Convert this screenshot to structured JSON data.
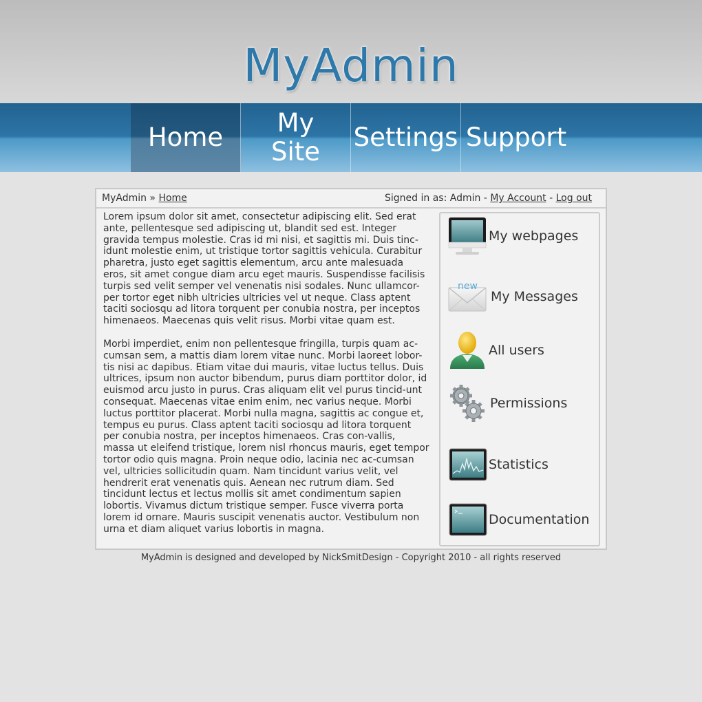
{
  "header": {
    "logo": "MyAdmin"
  },
  "nav": {
    "home": "Home",
    "my_site": "My\nSite",
    "settings": "Settings",
    "support": "Support"
  },
  "breadcrumb": {
    "root": "MyAdmin",
    "separator": " » ",
    "current": "Home"
  },
  "account": {
    "signed_in_prefix": "Signed in as: Admin - ",
    "my_account": "My Account",
    "dash": " - ",
    "logout": "Log out"
  },
  "content": {
    "para1": "Lorem ipsum dolor sit amet, consectetur adipiscing elit. Sed erat ante, pellentesque sed adipiscing ut, blandit sed est. Integer gravida tempus molestie. Cras id mi nisi, et sagittis mi. Duis tinc-idunt molestie enim, ut tristique tortor sagittis vehicula. Curabitur pharetra, justo eget sagittis elementum, arcu ante malesuada eros, sit amet congue diam arcu eget mauris. Suspendisse facilisis turpis sed velit semper vel venenatis nisi sodales. Nunc ullamcor-per tortor eget nibh ultricies ultricies vel ut neque. Class aptent taciti sociosqu ad litora torquent per conubia nostra, per inceptos himenaeos. Maecenas quis velit risus. Morbi vitae quam est.",
    "para2": "Morbi imperdiet, enim non pellentesque fringilla, turpis quam ac-cumsan sem, a mattis diam lorem vitae nunc. Morbi laoreet lobor-tis nisi ac dapibus. Etiam vitae dui mauris, vitae luctus tellus. Duis ultrices, ipsum non auctor bibendum, purus diam porttitor dolor, id euismod arcu justo in purus. Cras aliquam elit vel purus tincid-unt consequat. Maecenas vitae enim enim, nec varius neque. Morbi luctus porttitor placerat. Morbi nulla magna, sagittis ac congue et, tempus eu purus. Class aptent taciti sociosqu ad litora torquent per conubia nostra, per inceptos himenaeos. Cras con-vallis, massa ut eleifend tristique, lorem nisl rhoncus mauris, eget tempor tortor odio quis magna. Proin neque odio, lacinia nec ac-cumsan vel, ultricies sollicitudin quam. Nam tincidunt varius velit, vel hendrerit erat venenatis quis. Aenean nec rutrum diam. Sed tincidunt lectus et lectus mollis sit amet condimentum sapien lobortis. Vivamus dictum tristique semper. Fusce viverra porta lorem id ornare. Mauris suscipit venenatis auctor. Vestibulum non urna et diam aliquet varius lobortis in magna."
  },
  "sidebar": {
    "webpages": {
      "label": "My webpages",
      "icon": "monitor-icon"
    },
    "messages": {
      "label": "My Messages",
      "icon": "envelope-icon",
      "badge": "new"
    },
    "users": {
      "label": "All users",
      "icon": "user-icon"
    },
    "permissions": {
      "label": "Permissions",
      "icon": "gears-icon"
    },
    "statistics": {
      "label": "Statistics",
      "icon": "chart-screen-icon"
    },
    "documentation": {
      "label": "Documentation",
      "icon": "terminal-screen-icon"
    }
  },
  "footer": {
    "text": "MyAdmin is designed and developed by NickSmitDesign - Copyright 2010 - all rights reserved"
  },
  "colors": {
    "accent": "#2e78aa",
    "nav_top": "#226391",
    "nav_bottom": "#8ec0e0",
    "page_bg": "#e3e3e3"
  }
}
